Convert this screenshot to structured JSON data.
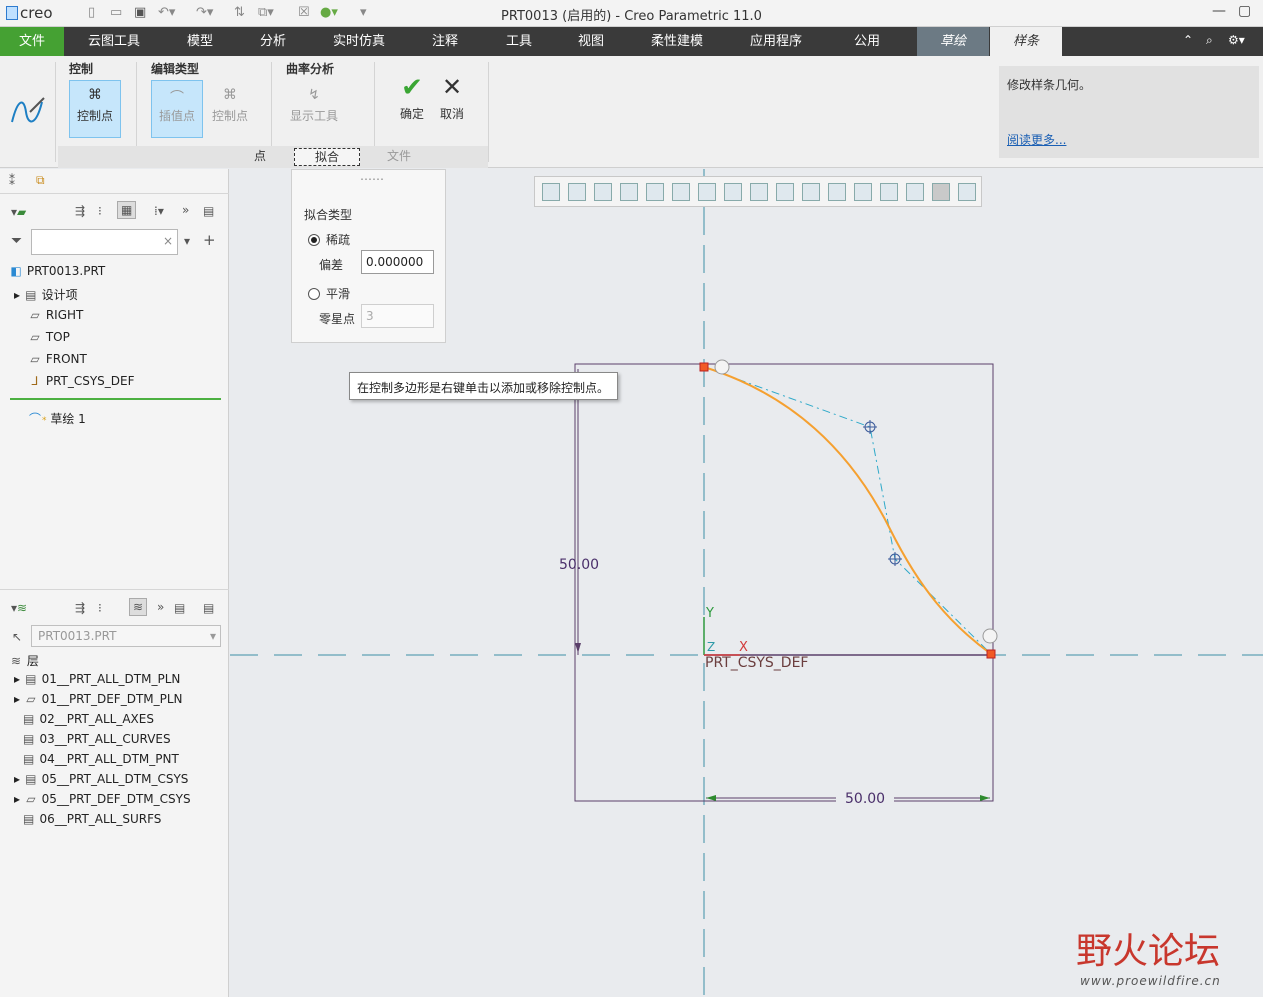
{
  "app": {
    "logo": "creo",
    "window_title": "PRT0013 (启用的) - Creo Parametric 11.0"
  },
  "tabs": [
    {
      "label": "文件"
    },
    {
      "label": "云图工具"
    },
    {
      "label": "模型"
    },
    {
      "label": "分析"
    },
    {
      "label": "实时仿真"
    },
    {
      "label": "注释"
    },
    {
      "label": "工具"
    },
    {
      "label": "视图"
    },
    {
      "label": "柔性建模"
    },
    {
      "label": "应用程序"
    },
    {
      "label": "公用"
    },
    {
      "label": "草绘"
    },
    {
      "label": "样条"
    }
  ],
  "ribbon": {
    "control_title": "控制",
    "control_points_label": "控制点",
    "edit_type_title": "编辑类型",
    "interp_points_label": "插值点",
    "edit_control_points_label": "控制点",
    "curvature_title": "曲率分析",
    "display_tool_label": "显示工具",
    "ok_label": "确定",
    "cancel_label": "取消",
    "subtabs": [
      "点",
      "拟合",
      "文件"
    ],
    "help_text": "修改样条几何。",
    "help_link": "阅读更多..."
  },
  "fit_panel": {
    "title": "拟合类型",
    "sparse_label": "稀疏",
    "tolerance_label": "偏差",
    "tolerance_value": "0.000000",
    "smooth_label": "平滑",
    "sparse_points_label": "零星点",
    "sparse_points_value": "3"
  },
  "tooltip": "在控制多边形是右键单击以添加或移除控制点。",
  "model_tree": {
    "root": "PRT0013.PRT",
    "items": [
      "设计项",
      "RIGHT",
      "TOP",
      "FRONT",
      "PRT_CSYS_DEF"
    ],
    "sketch": "草绘 1"
  },
  "layer_tree": {
    "model_select": "PRT0013.PRT",
    "header": "层",
    "items": [
      "01__PRT_ALL_DTM_PLN",
      "01__PRT_DEF_DTM_PLN",
      "02__PRT_ALL_AXES",
      "03__PRT_ALL_CURVES",
      "04__PRT_ALL_DTM_PNT",
      "05__PRT_ALL_DTM_CSYS",
      "05__PRT_DEF_DTM_CSYS",
      "06__PRT_ALL_SURFS"
    ]
  },
  "sketch": {
    "dim_vertical": "50.00",
    "dim_horizontal": "50.00",
    "csys_label": "PRT_CSYS_DEF",
    "axis_y": "Y",
    "axis_x": "X",
    "axis_z": "Z",
    "spline_color": "#f5a030",
    "polygon_color": "#2ea9c9",
    "sketch_color": "#5a3f6a"
  },
  "watermark": {
    "text": "野火论坛",
    "url": "www.proewildfire.cn"
  }
}
